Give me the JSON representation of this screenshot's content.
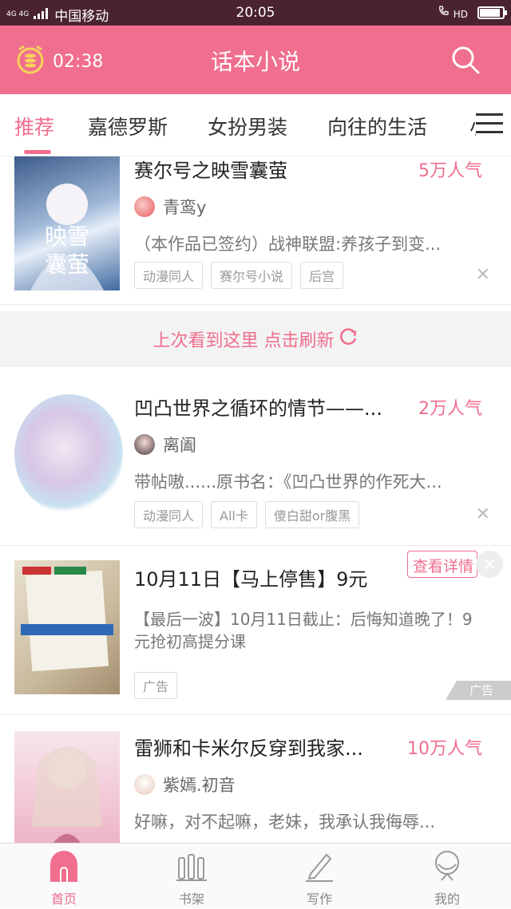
{
  "status_bar": {
    "network": "4G 4G",
    "carrier": "中国移动",
    "time": "20:05",
    "hd": "HD",
    "battery_level": 0.9
  },
  "header": {
    "timer": "02:38",
    "title": "话本小说"
  },
  "tabs": [
    "推荐",
    "嘉德罗斯",
    "女扮男装",
    "向往的生活",
    "小"
  ],
  "active_tab": 0,
  "refresh_banner": "上次看到这里 点击刷新",
  "items": [
    {
      "title": "赛尔号之映雪囊萤",
      "popularity": "5万人气",
      "author": "青鸾y",
      "description": "（本作品已签约）战神联盟:养孩子到变...",
      "tags": [
        "动漫同人",
        "赛尔号小说",
        "后宫"
      ]
    },
    {
      "title": "凹凸世界之循环的情节——...",
      "popularity": "2万人气",
      "author": "离阖",
      "description": "带帖嗷......原书名：《凹凸世界的作死大...",
      "tags": [
        "动漫同人",
        "All卡",
        "傻白甜or腹黑"
      ]
    },
    {
      "title": "雷狮和卡米尔反穿到我家...",
      "popularity": "10万人气",
      "author": "紫嫣.初音",
      "description": "好嘛，对不起嘛，老妹，我承认我侮辱..."
    }
  ],
  "ad": {
    "title": "10月11日【马上停售】9元",
    "detail_button": "查看详情",
    "description": "【最后一波】10月11日截止：后悔知道晚了！9元抢初高提分课",
    "tag": "广告",
    "mark": "广告"
  },
  "bottom_nav": [
    "首页",
    "书架",
    "写作",
    "我的"
  ],
  "colors": {
    "accent": "#f06e8e",
    "status_bar": "#4a2330"
  }
}
